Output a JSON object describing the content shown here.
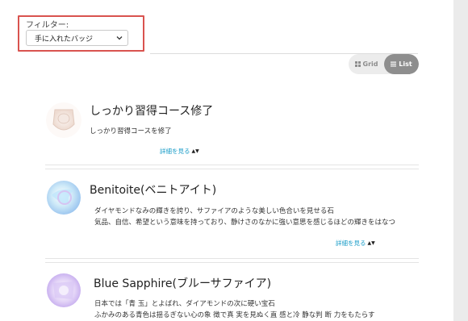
{
  "filter": {
    "label": "フィルター:",
    "selected": "手に入れたバッジ"
  },
  "view_toggle": {
    "grid_label": "Grid",
    "list_label": "List",
    "active": "List"
  },
  "badges": [
    {
      "title": "しっかり習得コース修了",
      "description": [
        "しっかり習得コースを修了"
      ],
      "more_label": "詳細を見る"
    },
    {
      "title": "Benitoite(ベニトアイト)",
      "description": [
        "ダイヤモンドなみの輝きを誇り、サファイアのような美しい色合いを見せる石",
        "気品、自信、希望という意味を持っており、静けさのなかに強い意思を感じるほどの輝きをはなつ"
      ],
      "more_label": "詳細を見る"
    },
    {
      "title": "Blue Sapphire(ブルーサファイア)",
      "description": [
        "日本では「青 玉」とよばれ、ダイアモンドの次に硬い宝石",
        "ふかみのある青色は揺るぎない心の象 徴で真 実を見ぬく直 感と冷 静な判 断 力をもたらす"
      ],
      "more_label": ""
    }
  ],
  "colors": {
    "filter_highlight": "#d9534f",
    "link": "#1a9dc8",
    "toggle_active": "#8e8e8e"
  }
}
